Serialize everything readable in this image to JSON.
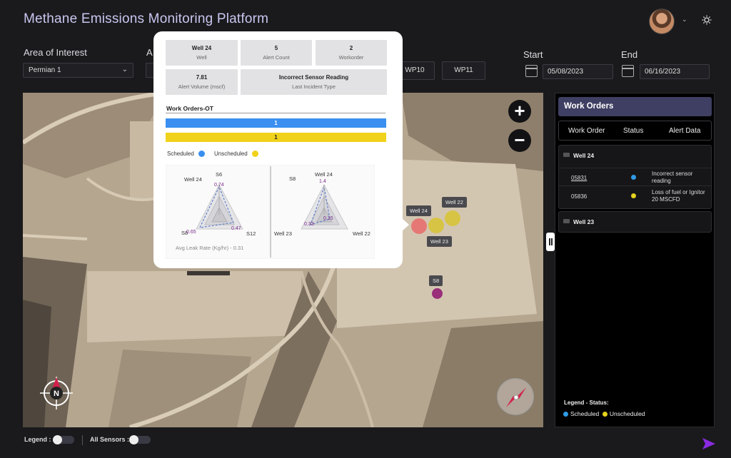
{
  "app": {
    "title": "Methane Emissions Monitoring Platform"
  },
  "filters": {
    "area_label": "Area of Interest",
    "area_value": "Permian 1",
    "second_label": "A",
    "wp_buttons": [
      "WP10",
      "WP11"
    ],
    "start_label": "Start",
    "start_date": "05/08/2023",
    "end_label": "End",
    "end_date": "06/16/2023"
  },
  "popup": {
    "stats": [
      {
        "value": "Well 24",
        "label": "Well"
      },
      {
        "value": "5",
        "label": "Alert Count"
      },
      {
        "value": "2",
        "label": "Workorder"
      },
      {
        "value": "7.81",
        "label": "Alert Volume (mscf)"
      },
      {
        "value": "Incorrect Sensor Reading",
        "label": "Last Incident Type"
      }
    ],
    "work_orders_title": "Work Orders-OT",
    "scheduled_bar_value": "1",
    "unscheduled_bar_value": "1",
    "legend_scheduled": "Scheduled",
    "legend_unscheduled": "Unscheduled",
    "radar_left": {
      "labels": {
        "top_left": "Well 24",
        "top": "S6",
        "bottom_left": "S8",
        "bottom_right": "S12"
      },
      "values": {
        "top": "0.74",
        "bottom_left": "0.65",
        "bottom_right": "0.47"
      }
    },
    "radar_right": {
      "labels": {
        "top_left": "S8",
        "top": "Well 24",
        "bottom_left": "Well 23",
        "bottom_right": "Well 22"
      },
      "values": {
        "top": "1.4",
        "left": "0.33",
        "right": "0.15"
      }
    },
    "avg_leak": "Avg Leak Rate (Kg/hr) - 0.31"
  },
  "map": {
    "markers": [
      {
        "label": "Well 24",
        "color": "#e86a6a"
      },
      {
        "label": "Well 22",
        "color": "#d8c32a"
      },
      {
        "label": "Well 23",
        "color": "#d8c32a"
      },
      {
        "label": "S8",
        "color": "#9a2f7a"
      }
    ],
    "compass_letter": "N"
  },
  "work_orders": {
    "title": "Work Orders",
    "columns": [
      "Work Order",
      "Status",
      "Alert Data"
    ],
    "groups": [
      {
        "name": "Well 24",
        "rows": [
          {
            "number": "05831",
            "status_color": "#2f9be8",
            "alert": "Incorrect sensor reading"
          },
          {
            "number": "05836",
            "status_color": "#e6d21f",
            "alert": "Loss of fuel or Ignitor 20 MSCFD"
          }
        ]
      },
      {
        "name": "Well 23",
        "rows": []
      }
    ],
    "legend_title": "Legend - Status:",
    "legend_scheduled": "Scheduled",
    "legend_unscheduled": "Unscheduled",
    "scheduled_color": "#2f9be8",
    "unscheduled_color": "#e6d21f"
  },
  "footer": {
    "legend_label": "Legend :",
    "sensors_label": "All Sensors :"
  },
  "colors": {
    "accent": "#8a2be2",
    "scheduled_bar": "#3a8ff0",
    "unscheduled_bar": "#f0d21c"
  }
}
